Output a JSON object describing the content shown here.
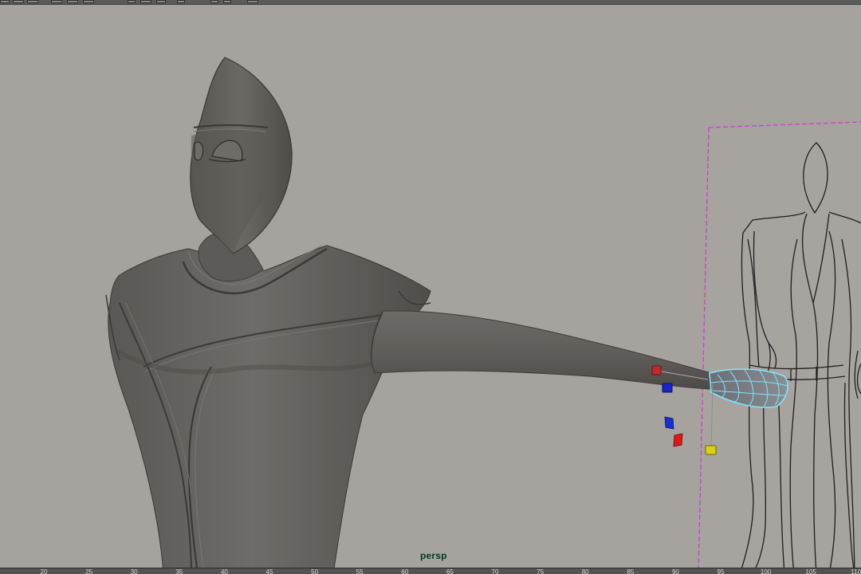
{
  "viewport": {
    "camera_label": "persp",
    "background_color": "#a6a29e",
    "selection_color": "#7fe3ff",
    "image_plane_border_color": "#d03cd0"
  },
  "toolbar": {
    "buttons": [
      {
        "icon": "select-icon"
      },
      {
        "icon": "lasso-icon"
      },
      {
        "icon": "paint-select-icon"
      },
      {
        "icon": "move-icon"
      },
      {
        "icon": "rotate-icon"
      },
      {
        "icon": "scale-icon"
      },
      {
        "icon": "snap-grid-icon"
      },
      {
        "icon": "snap-curve-icon"
      },
      {
        "icon": "snap-point-icon"
      },
      {
        "icon": "render-icon"
      },
      {
        "icon": "ipr-render-icon"
      },
      {
        "icon": "render-settings-icon"
      },
      {
        "icon": "show-hide-panel-icon"
      }
    ]
  },
  "timeline": {
    "ticks": [
      "20",
      "25",
      "30",
      "35",
      "40",
      "45",
      "50",
      "55",
      "60",
      "65",
      "70",
      "75",
      "80",
      "85",
      "90",
      "95",
      "100",
      "105",
      "110"
    ]
  }
}
